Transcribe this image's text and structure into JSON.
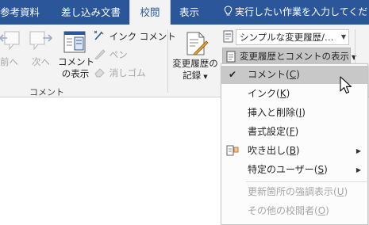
{
  "tabs": [
    {
      "label": "参考資料"
    },
    {
      "label": "差し込み文書"
    },
    {
      "label": "校閲"
    },
    {
      "label": "表示"
    }
  ],
  "tell_me": {
    "text": "実行したい作業を入力してください"
  },
  "ribbon": {
    "prev_label": "前へ",
    "next_label": "次へ",
    "show_comments_line1": "コメント",
    "show_comments_line2": "の表示",
    "ink_comment_label": "インク コメント",
    "pen_label": "ペン",
    "eraser_label": "消しゴム",
    "group_comments_label": "コメント",
    "track_changes_line1": "変更履歴の",
    "track_changes_line2": "記録",
    "display_for_review_value": "シンプルな変更履歴/…",
    "show_markup_label": "変更履歴とコメントの表示"
  },
  "menu": {
    "items": [
      {
        "label": "コメント(",
        "key": "C",
        "suffix": ")",
        "checked": true,
        "selected": true,
        "submenu": false,
        "enabled": true
      },
      {
        "label": "インク(",
        "key": "K",
        "suffix": ")",
        "checked": false,
        "submenu": false,
        "enabled": true
      },
      {
        "label": "挿入と削除(",
        "key": "I",
        "suffix": ")",
        "checked": false,
        "submenu": false,
        "enabled": true
      },
      {
        "label": "書式設定(",
        "key": "F",
        "suffix": ")",
        "checked": false,
        "submenu": false,
        "enabled": true
      },
      {
        "label": "吹き出し(",
        "key": "B",
        "suffix": ")",
        "checked": false,
        "submenu": true,
        "enabled": true,
        "icon": "balloon-icon"
      },
      {
        "label": "特定のユーザー(",
        "key": "S",
        "suffix": ")",
        "checked": false,
        "submenu": true,
        "enabled": true
      },
      {
        "label": "更新箇所の強調表示(",
        "key": "U",
        "suffix": ")",
        "checked": false,
        "submenu": false,
        "enabled": false
      },
      {
        "label": "その他の校閲者(",
        "key": "O",
        "suffix": ")",
        "checked": false,
        "submenu": false,
        "enabled": false
      }
    ]
  },
  "colors": {
    "tab_bar": "#2b579a",
    "ribbon_bg": "#f3f3f3",
    "menu_highlight": "#c8c8c8",
    "disabled_text": "#a6a6a6"
  }
}
